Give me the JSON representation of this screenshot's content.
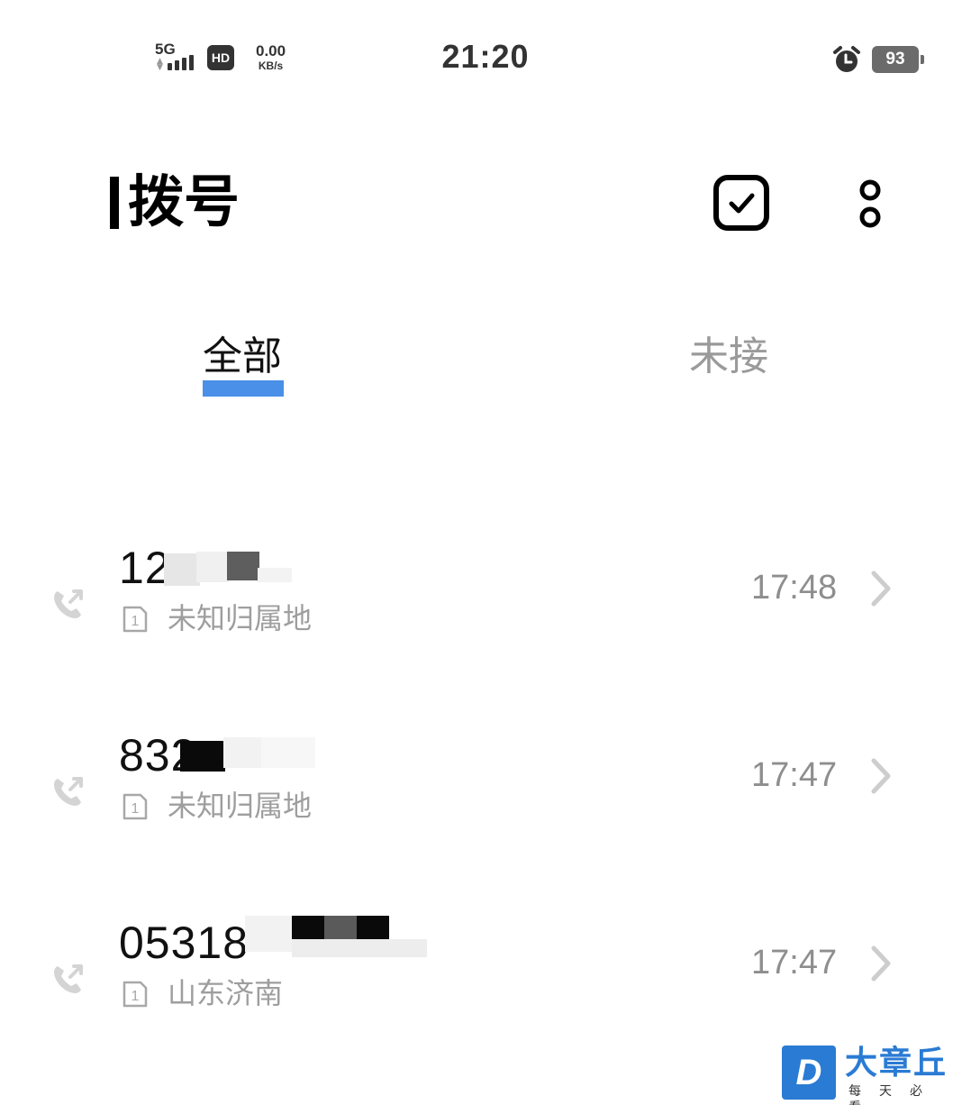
{
  "status_bar": {
    "network": "5G",
    "hd_label": "HD",
    "net_speed_value": "0.00",
    "net_speed_unit": "KB/s",
    "time": "21:20",
    "alarm_icon": "alarm-clock-icon",
    "battery_level": "93"
  },
  "header": {
    "title": "拨号",
    "select_icon": "checkbox-select-icon",
    "more_icon": "more-options-icon"
  },
  "tabs": [
    {
      "label": "全部",
      "active": true
    },
    {
      "label": "未接",
      "active": false
    }
  ],
  "calls": [
    {
      "number_visible": "12",
      "location": "未知归属地",
      "time": "17:48",
      "sim": "1",
      "icon": "outgoing-call-icon"
    },
    {
      "number_visible": "832",
      "location": "未知归属地",
      "time": "17:47",
      "sim": "1",
      "icon": "outgoing-call-icon"
    },
    {
      "number_visible": "05318",
      "location": "山东济南",
      "time": "17:47",
      "sim": "1",
      "icon": "outgoing-call-icon"
    }
  ],
  "watermark": {
    "logo_letter": "D",
    "name": "大章丘",
    "slogan": "每天必看"
  },
  "colors": {
    "accent": "#4a90e8",
    "secondary_text": "#9e9e9e",
    "watermark_blue": "#2a7bd4"
  }
}
